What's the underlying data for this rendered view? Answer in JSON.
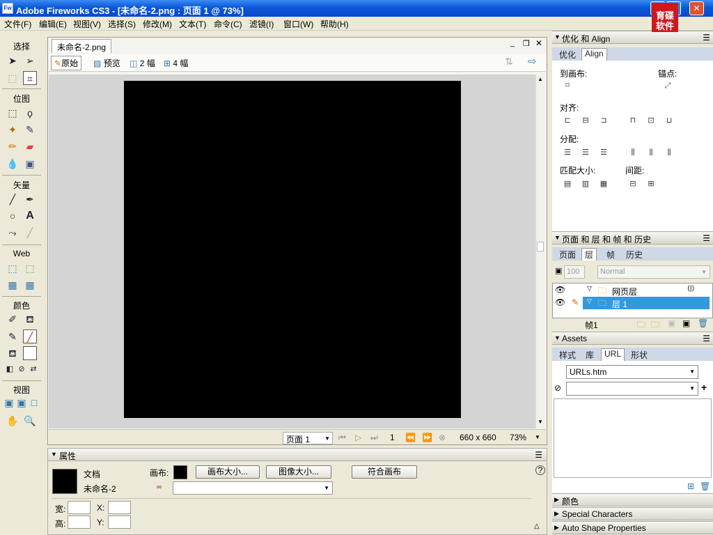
{
  "window": {
    "title": "Adobe Fireworks CS3 - [未命名-2.png : 页面 1 @ 73%]",
    "app_icon": "Fw",
    "minimize": "_",
    "maximize": "□",
    "close": "✕"
  },
  "badge": {
    "line1": "育碟",
    "line2": "软件"
  },
  "menu": [
    "文件(F)",
    "编辑(E)",
    "视图(V)",
    "选择(S)",
    "修改(M)",
    "文本(T)",
    "命令(C)",
    "滤镜(I)",
    "窗口(W)",
    "帮助(H)"
  ],
  "tools": {
    "select": "选择",
    "bitmap": "位图",
    "vector": "矢量",
    "web": "Web",
    "colors": "颜色",
    "view": "视图"
  },
  "document": {
    "tab": "未命名-2.png",
    "views": {
      "original": "原始",
      "preview": "预览",
      "two_up": "2 幅",
      "four_up": "4 幅"
    },
    "status": {
      "page": "页面 1",
      "frame": "1",
      "size": "660 x 660",
      "zoom": "73%"
    }
  },
  "properties": {
    "title": "属性",
    "doc_label": "文档",
    "doc_name": "未命名-2",
    "canvas_label": "画布:",
    "canvas_size_btn": "画布大小...",
    "image_size_btn": "图像大小...",
    "fit_canvas_btn": "符合画布",
    "width_label": "宽:",
    "height_label": "高:",
    "x_label": "X:",
    "y_label": "Y:",
    "canvas_color": "#000000"
  },
  "align_panel": {
    "title": "优化 和 Align",
    "tabs": [
      "优化",
      "Align"
    ],
    "to_canvas": "到画布:",
    "anchor": "锚点:",
    "align": "对齐:",
    "distribute": "分配:",
    "match_size": "匹配大小:",
    "spacing": "间距:"
  },
  "layers_panel": {
    "title": "页面 和 层 和 帧 和 历史",
    "tabs": [
      "页面",
      "层",
      "帧",
      "历史"
    ],
    "opacity": "100",
    "blend": "Normal",
    "layers": [
      "网页层",
      "层 1"
    ],
    "frame": "帧1"
  },
  "assets_panel": {
    "title": "Assets",
    "tabs": [
      "样式",
      "库",
      "URL",
      "形状"
    ],
    "url_file": "URLs.htm"
  },
  "collapsed_panels": [
    "颜色",
    "Special Characters",
    "Auto Shape Properties"
  ],
  "colors": {
    "titlebar": "#0a58d8",
    "selection": "#3399dd",
    "badge": "#d0181c"
  }
}
